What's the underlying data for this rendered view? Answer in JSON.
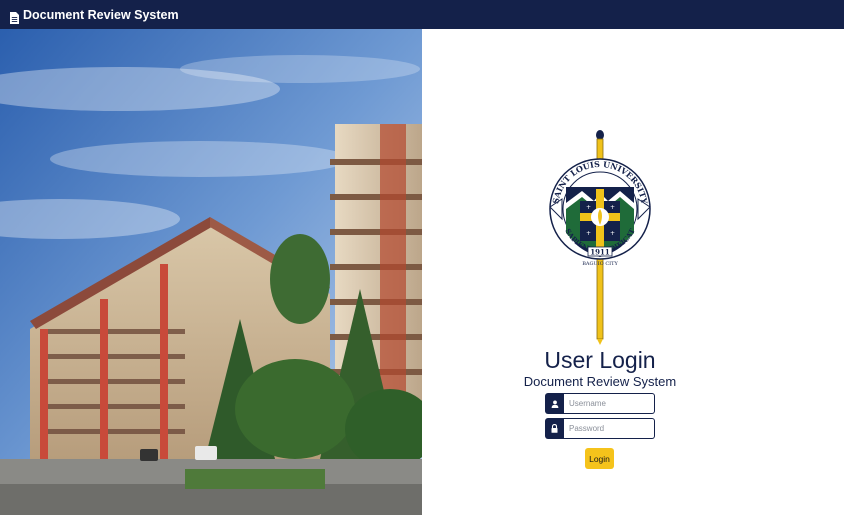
{
  "app": {
    "brand": "Document Review System"
  },
  "hero": {
    "description_icon": "campus-building-photo"
  },
  "seal": {
    "top_text": "SAINT LOUIS UNIVERSITY",
    "bottom_text": "SAPIENTIA ÆDIFICAT",
    "year": "1911",
    "city": "BAGUIO CITY"
  },
  "login": {
    "title": "User Login",
    "subtitle": "Document Review System",
    "username_placeholder": "Username",
    "password_placeholder": "Password",
    "button_label": "Login"
  },
  "colors": {
    "navy": "#14214a",
    "gold": "#f5c31b"
  },
  "icons": {
    "brand": "document-icon",
    "username": "user-icon",
    "password": "lock-icon"
  }
}
